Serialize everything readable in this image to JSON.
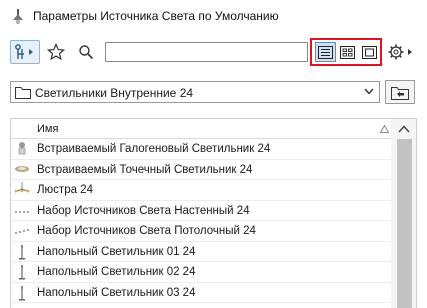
{
  "window": {
    "title": "Параметры Источника Света по Умолчанию",
    "icon": "light-fixture-icon"
  },
  "toolbar": {
    "filter_icon": "filter-dropdown-icon",
    "favorites_icon": "star-icon",
    "search_icon": "search-icon",
    "search_value": "",
    "search_placeholder": "",
    "view_modes": [
      {
        "name": "list-view-icon",
        "selected": true
      },
      {
        "name": "grid-view-icon",
        "selected": false
      },
      {
        "name": "preview-view-icon",
        "selected": false
      }
    ],
    "settings_icon": "gear-icon",
    "highlight_color": "#e0141e"
  },
  "folder": {
    "label": "Светильники Внутренние 24",
    "icon": "folder-icon",
    "up_icon": "folder-up-icon"
  },
  "list": {
    "column_header": "Имя",
    "sort_icon": "sort-triangle-icon",
    "rows": [
      {
        "label": "Встраиваемый Галогеновый Светильник 24",
        "thumb": "halogen"
      },
      {
        "label": "Встраиваемый Точечный Светильник 24",
        "thumb": "spot"
      },
      {
        "label": "Люстра 24",
        "thumb": "chandelier"
      },
      {
        "label": "Набор Источников Света Настенный 24",
        "thumb": "wall"
      },
      {
        "label": "Набор Источников Света Потолочный 24",
        "thumb": "ceiling"
      },
      {
        "label": "Напольный Светильник 01 24",
        "thumb": "floor"
      },
      {
        "label": "Напольный Светильник 02 24",
        "thumb": "floor"
      },
      {
        "label": "Напольный Светильник 03 24",
        "thumb": "floor"
      }
    ]
  }
}
